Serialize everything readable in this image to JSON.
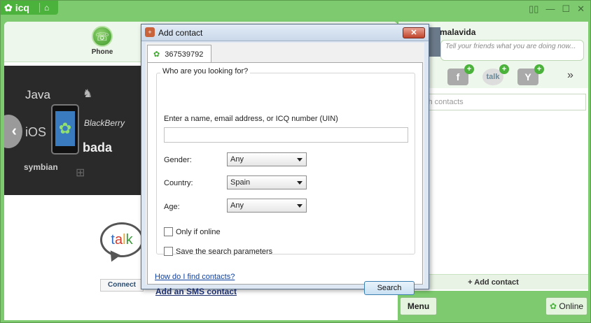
{
  "app": {
    "logo_text": "icq"
  },
  "left": {
    "phone_label": "Phone",
    "banner": {
      "java": "Java",
      "ios": "iOS",
      "blackberry": "BlackBerry",
      "bada": "bada",
      "symbian": "symbian"
    },
    "talk_letters": [
      "t",
      "a",
      "l",
      "k"
    ],
    "connect_label": "Connect"
  },
  "right": {
    "username": "malavida",
    "status_placeholder": "Tell your friends what you are doing now...",
    "search_placeholder": "ch contacts",
    "add_contact_label": "Add contact",
    "menu_label": "Menu",
    "online_label": "Online"
  },
  "dialog": {
    "title": "Add contact",
    "close_glyph": "✕",
    "tab_label": "367539792",
    "group_label": "Who are you looking for?",
    "name_prompt": "Enter a name, email address, or ICQ number (UIN)",
    "name_value": "",
    "gender_label": "Gender:",
    "gender_value": "Any",
    "country_label": "Country:",
    "country_value": "Spain",
    "age_label": "Age:",
    "age_value": "Any",
    "only_online_label": "Only if online",
    "save_params_label": "Save the search parameters",
    "help_link": "How do I find contacts?",
    "sms_link": "Add an SMS contact",
    "search_button": "Search"
  }
}
